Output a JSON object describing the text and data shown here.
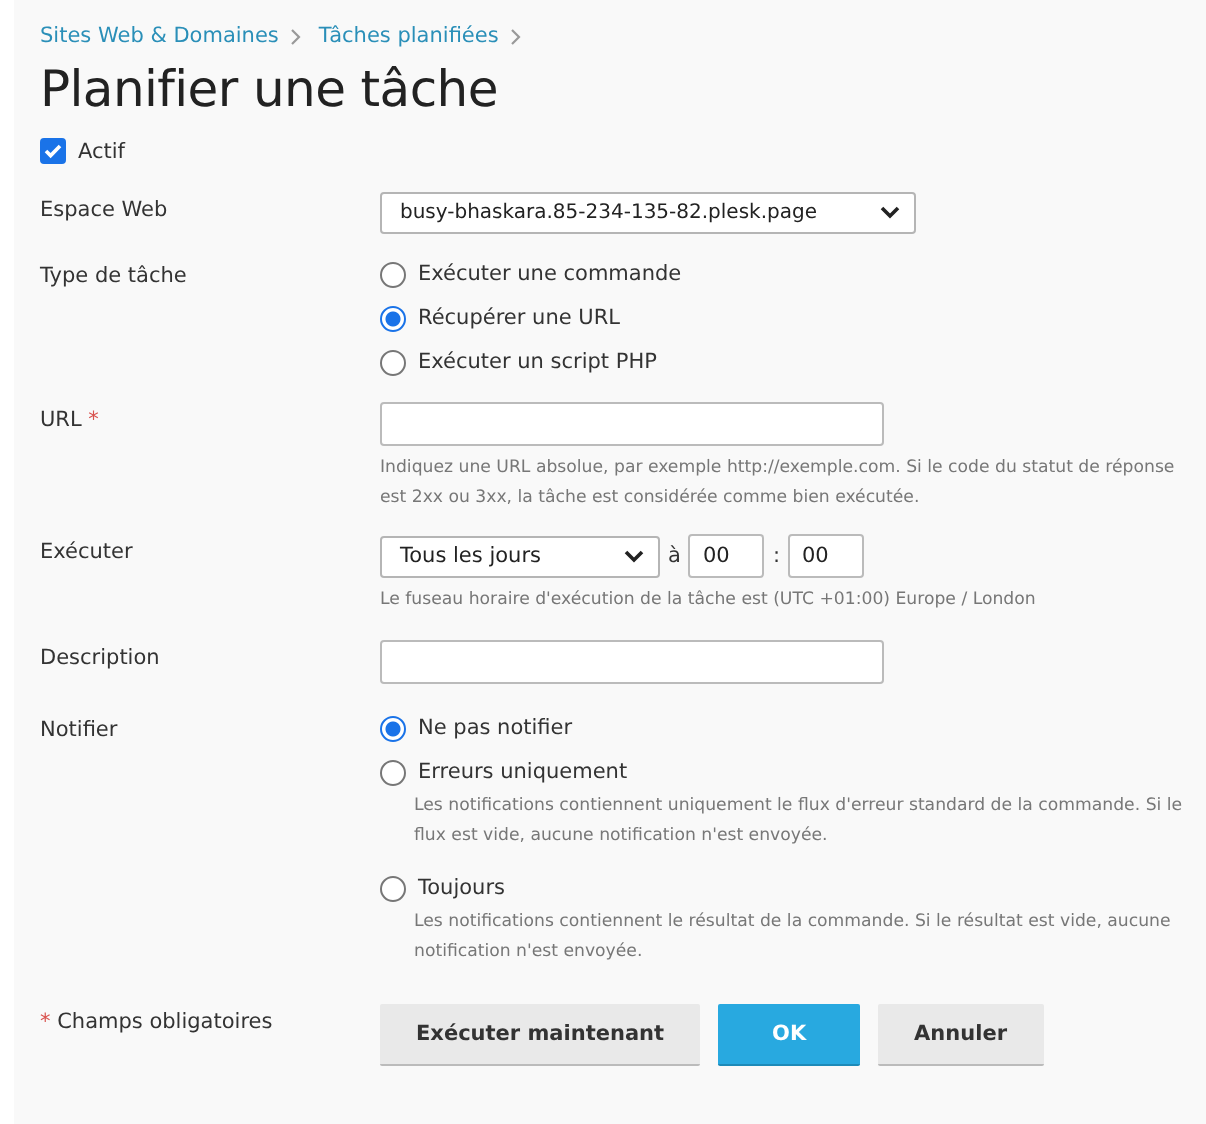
{
  "breadcrumbs": [
    "Sites Web & Domaines",
    "Tâches planifiées"
  ],
  "title": "Planifier une tâche",
  "active": {
    "label": "Actif",
    "checked": true
  },
  "webspace": {
    "label": "Espace Web",
    "value": "busy-bhaskara.85-234-135-82.plesk.page"
  },
  "task_type": {
    "label": "Type de tâche",
    "options": [
      {
        "label": "Exécuter une commande",
        "selected": false
      },
      {
        "label": "Récupérer une URL",
        "selected": true
      },
      {
        "label": "Exécuter un script PHP",
        "selected": false
      }
    ]
  },
  "url": {
    "label": "URL",
    "required": true,
    "hint": "Indiquez une URL absolue, par exemple http://exemple.com. Si le code du statut de réponse est 2xx ou 3xx, la tâche est considérée comme bien exécutée."
  },
  "run": {
    "label": "Exécuter",
    "frequency": "Tous les jours",
    "at": "à",
    "hour": "00",
    "separator": ":",
    "minute": "00",
    "hint": "Le fuseau horaire d'exécution de la tâche est (UTC +01:00) Europe / London"
  },
  "description": {
    "label": "Description"
  },
  "notify": {
    "label": "Notifier",
    "options": [
      {
        "label": "Ne pas notifier",
        "selected": true
      },
      {
        "label": "Erreurs uniquement",
        "selected": false,
        "hint": "Les notifications contiennent uniquement le flux d'erreur standard de la commande. Si le flux est vide, aucune notification n'est envoyée."
      },
      {
        "label": "Toujours",
        "selected": false,
        "hint": "Les notifications contiennent le résultat de la commande. Si le résultat est vide, aucune notification n'est envoyée."
      }
    ]
  },
  "required_note": {
    "mark": "*",
    "text": "Champs obligatoires"
  },
  "buttons": [
    {
      "label": "Exécuter maintenant",
      "kind": "default"
    },
    {
      "label": "OK",
      "kind": "primary"
    },
    {
      "label": "Annuler",
      "kind": "default"
    }
  ]
}
